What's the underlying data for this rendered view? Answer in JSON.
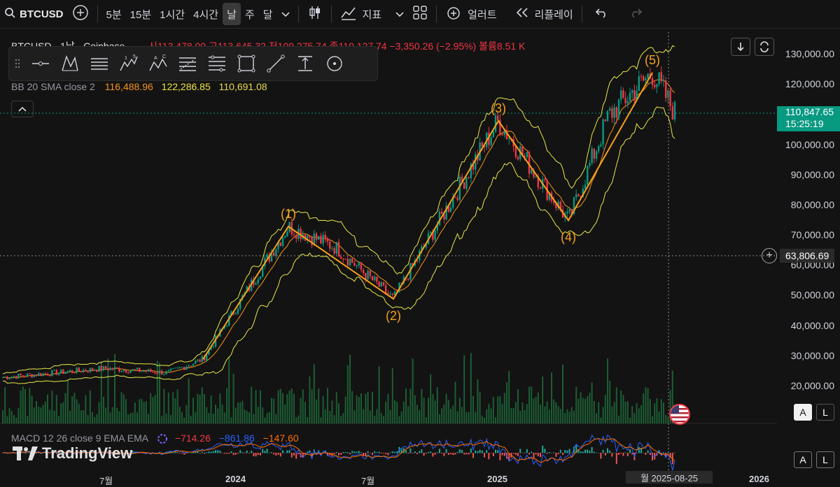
{
  "topbar": {
    "symbol": "BTCUSD",
    "intervals": [
      "5분",
      "15분",
      "1시간",
      "4시간",
      "날",
      "주",
      "달"
    ],
    "indicators_label": "지표",
    "alert_label": "얼러트",
    "replay_label": "리플레이"
  },
  "legend": {
    "title": "BTCUSD · 1날 · Coinbase",
    "open_label": "시",
    "open": "113,478.00",
    "high_label": "고",
    "high": "113,645.32",
    "low_label": "저",
    "low": "109,275.74",
    "close_label": "종",
    "close": "110,127.74",
    "change": "−3,350.26 (−2.95%)",
    "volume_label": "볼륨",
    "volume": "8.51 K"
  },
  "bb": {
    "label": "BB 20 SMA close 2",
    "basis": "116,488.96",
    "upper": "122,286.85",
    "lower": "110,691.08"
  },
  "macd": {
    "label": "MACD 12 26 close 9 EMA EMA",
    "histogram": "−714.26",
    "macd": "−861.86",
    "signal": "−147.60"
  },
  "brand": "TradingView",
  "price_axis": [
    "130,000.00",
    "120,000.00",
    "100,000.00",
    "90,000.00",
    "80,000.00",
    "70,000.00",
    "60,000.00",
    "50,000.00",
    "40,000.00",
    "30,000.00",
    "20,000.00"
  ],
  "last_price": "110,847.65",
  "countdown": "15:25:19",
  "crosshair_price": "63,806.69",
  "crosshair_date": "월 2025-08-25",
  "time_axis": [
    "7월",
    "2024",
    "7월",
    "2025",
    "2026"
  ],
  "auto_label": "A",
  "log_label": "L",
  "wave_labels": [
    "(1)",
    "(2)",
    "(3)",
    "(4)",
    "(5)"
  ],
  "colors": {
    "up": "#089981",
    "down": "#f23645",
    "wave": "#f7a01a",
    "bb": "#e8e84a"
  },
  "chart_data": {
    "type": "candlestick",
    "series": [
      {
        "name": "Elliott wave",
        "x": [
          "2023-07",
          "2024-03",
          "2024-09",
          "2024-12",
          "2025-04",
          "2025-08"
        ],
        "values": [
          29000,
          73000,
          49000,
          108000,
          75000,
          124000
        ]
      }
    ],
    "ylim": [
      12000,
      135000
    ]
  }
}
